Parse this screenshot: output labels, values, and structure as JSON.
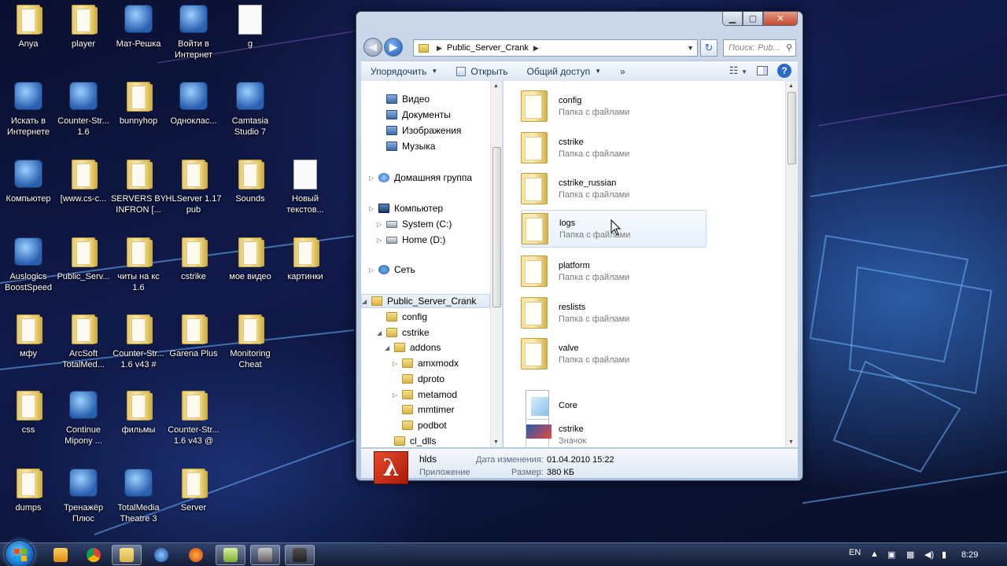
{
  "desktop": {
    "icons": [
      {
        "label": "Anya",
        "kind": "folder"
      },
      {
        "label": "player",
        "kind": "folder"
      },
      {
        "label": "Мат-Решка",
        "kind": "app"
      },
      {
        "label": "Войти в\nИнтернет",
        "kind": "app"
      },
      {
        "label": "g",
        "kind": "doc"
      },
      {
        "label": "Искать в\nИнтернете",
        "kind": "app"
      },
      {
        "label": "Counter-Str...\n1.6",
        "kind": "app"
      },
      {
        "label": "bunnyhop",
        "kind": "folder"
      },
      {
        "label": "Одноклас...",
        "kind": "app"
      },
      {
        "label": "Camtasia\nStudio 7",
        "kind": "app"
      },
      {
        "label": "Компьютер",
        "kind": "app"
      },
      {
        "label": "[www.cs-c...",
        "kind": "folder"
      },
      {
        "label": "SERVERS BY\nINFRON [...",
        "kind": "folder"
      },
      {
        "label": "HLServer 1.17\npub",
        "kind": "folder"
      },
      {
        "label": "Sounds",
        "kind": "folder"
      },
      {
        "label": "Новый\nтекстов...",
        "kind": "doc"
      },
      {
        "label": "Auslogics\nBoostSpeed",
        "kind": "app"
      },
      {
        "label": "Public_Serv...",
        "kind": "folder"
      },
      {
        "label": "читы на кс\n1.6",
        "kind": "folder"
      },
      {
        "label": "cstrike",
        "kind": "folder"
      },
      {
        "label": "мое видео",
        "kind": "folder"
      },
      {
        "label": "картинки",
        "kind": "folder"
      },
      {
        "label": "мфу",
        "kind": "folder"
      },
      {
        "label": "ArcSoft\nTotalMed...",
        "kind": "folder"
      },
      {
        "label": "Counter-Str...\n1.6 v43 #",
        "kind": "folder"
      },
      {
        "label": "Garena Plus",
        "kind": "folder"
      },
      {
        "label": "Monitoring\nCheat",
        "kind": "folder"
      },
      {
        "label": "css",
        "kind": "folder"
      },
      {
        "label": "Continue\nMipony ...",
        "kind": "app"
      },
      {
        "label": "фильмы",
        "kind": "folder"
      },
      {
        "label": "Counter-Str...\n1.6 v43 @",
        "kind": "folder"
      },
      {
        "label": "dumps",
        "kind": "folder"
      },
      {
        "label": "Тренажёр\nПлюс",
        "kind": "app"
      },
      {
        "label": "TotalMedia\nTheatre 3",
        "kind": "app"
      },
      {
        "label": "Server",
        "kind": "folder"
      }
    ]
  },
  "window": {
    "address_path": "Public_Server_Crank",
    "search_placeholder": "Поиск: Pub...",
    "toolbar": {
      "organize": "Упорядочить",
      "open": "Открыть",
      "share": "Общий доступ",
      "more": "»"
    },
    "nav_items": [
      {
        "label": "Видео",
        "icon": "video-library-icon"
      },
      {
        "label": "Документы",
        "icon": "documents-library-icon"
      },
      {
        "label": "Изображения",
        "icon": "pictures-library-icon"
      },
      {
        "label": "Музыка",
        "icon": "music-library-icon"
      },
      {
        "label": "Домашняя группа",
        "icon": "homegroup-icon"
      },
      {
        "label": "Компьютер",
        "icon": "computer-icon"
      },
      {
        "label": "System (C:)",
        "icon": "drive-icon"
      },
      {
        "label": "Home (D:)",
        "icon": "drive-icon"
      },
      {
        "label": "Сеть",
        "icon": "network-icon"
      },
      {
        "label": "Public_Server_Crank",
        "icon": "folder-icon"
      },
      {
        "label": "config",
        "icon": "folder-icon"
      },
      {
        "label": "cstrike",
        "icon": "folder-icon"
      },
      {
        "label": "addons",
        "icon": "folder-icon"
      },
      {
        "label": "amxmodx",
        "icon": "folder-icon"
      },
      {
        "label": "dproto",
        "icon": "folder-icon"
      },
      {
        "label": "metamod",
        "icon": "folder-icon"
      },
      {
        "label": "mmtimer",
        "icon": "folder-icon"
      },
      {
        "label": "podbot",
        "icon": "folder-icon"
      },
      {
        "label": "cl_dlls",
        "icon": "folder-icon"
      }
    ],
    "files": [
      {
        "name": "config",
        "type": "Папка с файлами",
        "icon": "folder"
      },
      {
        "name": "cstrike",
        "type": "Папка с файлами",
        "icon": "folder"
      },
      {
        "name": "cstrike_russian",
        "type": "Папка с файлами",
        "icon": "folder"
      },
      {
        "name": "logs",
        "type": "Папка с файлами",
        "icon": "folder"
      },
      {
        "name": "platform",
        "type": "Папка с файлами",
        "icon": "folder"
      },
      {
        "name": "reslists",
        "type": "Папка с файлами",
        "icon": "folder"
      },
      {
        "name": "valve",
        "type": "Папка с файлами",
        "icon": "folder"
      },
      {
        "name": "Core",
        "type": "",
        "icon": "core"
      },
      {
        "name": "cstrike",
        "type": "Значок",
        "icon": "cs"
      }
    ],
    "details": {
      "name": "hlds",
      "type": "Приложение",
      "modified_label": "Дата изменения:",
      "modified_value": "01.04.2010 15:22",
      "size_label": "Размер:",
      "size_value": "380 КБ",
      "icon_glyph": "λ"
    }
  },
  "taskbar": {
    "language": "EN",
    "time": "8:29"
  }
}
